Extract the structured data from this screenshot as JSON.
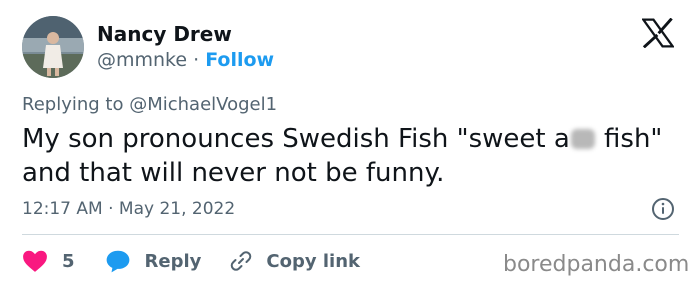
{
  "author": {
    "name": "Nancy Drew",
    "handle": "@mmnke",
    "separator": "·",
    "follow_label": "Follow"
  },
  "reply": {
    "prefix": "Replying to",
    "mention": "@MichaelVogel1"
  },
  "tweet": {
    "text_before": "My son pronounces Swedish Fish \"sweet a",
    "text_after": " fish\" and that will never not be funny."
  },
  "meta": {
    "time": "12:17 AM",
    "separator": "·",
    "date": "May 21, 2022"
  },
  "actions": {
    "like_count": "5",
    "reply_label": "Reply",
    "copy_label": "Copy link"
  },
  "watermark": "boredpanda.com",
  "icons": {
    "brand": "x-logo-icon",
    "like": "heart-icon",
    "reply": "speech-bubble-icon",
    "copy": "link-icon",
    "info": "info-icon"
  },
  "colors": {
    "text": "#0f1419",
    "secondary": "#536471",
    "accent": "#1d9bf0",
    "like": "#f91880",
    "divider": "#cfd9de"
  }
}
